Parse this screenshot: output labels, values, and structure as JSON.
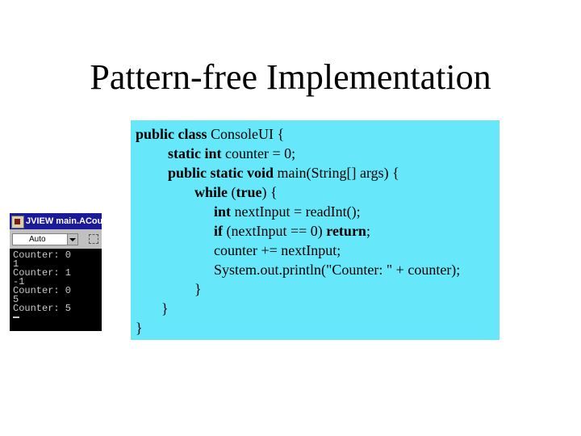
{
  "slide": {
    "title": "Pattern-free Implementation"
  },
  "code": {
    "lines": [
      [
        {
          "t": "public class ",
          "b": true
        },
        {
          "t": "ConsoleUI {",
          "b": false
        }
      ],
      [
        {
          "t": "static int ",
          "b": true
        },
        {
          "t": "counter = 0;",
          "b": false
        }
      ],
      [
        {
          "t": "public static void ",
          "b": true
        },
        {
          "t": "main(String[] args) {",
          "b": false
        }
      ],
      [
        {
          "t": "while ",
          "b": true
        },
        {
          "t": "(",
          "b": false
        },
        {
          "t": "true",
          "b": true
        },
        {
          "t": ") {",
          "b": false
        }
      ],
      [
        {
          "t": "int ",
          "b": true
        },
        {
          "t": "nextInput = readInt();",
          "b": false
        }
      ],
      [
        {
          "t": "if ",
          "b": true
        },
        {
          "t": "(nextInput == 0) ",
          "b": false
        },
        {
          "t": "return",
          "b": true
        },
        {
          "t": ";",
          "b": false
        }
      ],
      [
        {
          "t": "counter += nextInput;",
          "b": false
        }
      ],
      [
        {
          "t": "System.out.println(\"Counter: \" + counter);",
          "b": false
        }
      ],
      [
        {
          "t": "}",
          "b": false
        }
      ],
      [
        {
          "t": "}",
          "b": false
        }
      ],
      [
        {
          "t": "}",
          "b": false
        }
      ]
    ]
  },
  "console": {
    "title": "JVIEW main.ACou",
    "font_select_value": "Auto",
    "output": [
      "Counter: 0",
      "1",
      "Counter: 1",
      "-1",
      "Counter: 0",
      "5",
      "Counter: 5"
    ]
  },
  "colors": {
    "code_background": "#66e8fa",
    "console_background": "#000000",
    "console_titlebar": "#1a1a9a"
  }
}
